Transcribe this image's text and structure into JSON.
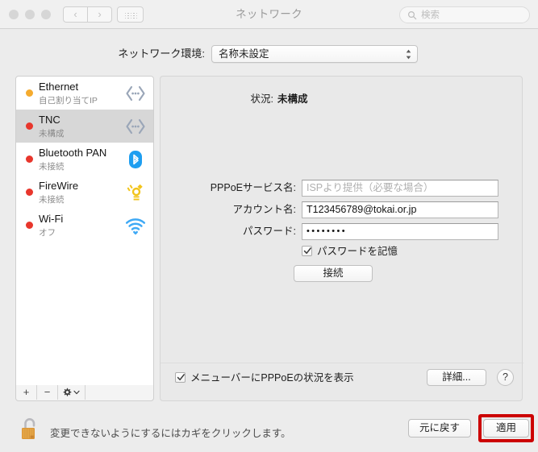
{
  "window": {
    "title": "ネットワーク",
    "traffic_lights": [
      "close",
      "minimize",
      "zoom"
    ]
  },
  "toolbar": {
    "back_glyph": "‹",
    "forward_glyph": "›",
    "show_all_name": "show-all-grid"
  },
  "search": {
    "placeholder": "検索",
    "value": ""
  },
  "location": {
    "label": "ネットワーク環境:",
    "selected": "名称未設定"
  },
  "sidebar": {
    "services": [
      {
        "name": "Ethernet",
        "status": "自己割り当てIP",
        "dot_color": "#f5ab2e",
        "icon": "ethernet-icon",
        "selected": false
      },
      {
        "name": "TNC",
        "status": "未構成",
        "dot_color": "#e8362c",
        "icon": "ethernet-icon",
        "selected": true
      },
      {
        "name": "Bluetooth PAN",
        "status": "未接続",
        "dot_color": "#e8362c",
        "icon": "bluetooth-icon",
        "selected": false
      },
      {
        "name": "FireWire",
        "status": "未接続",
        "dot_color": "#e8362c",
        "icon": "firewire-icon",
        "selected": false
      },
      {
        "name": "Wi-Fi",
        "status": "オフ",
        "dot_color": "#e8362c",
        "icon": "wifi-icon",
        "selected": false
      }
    ],
    "footer": {
      "add_label": "+",
      "remove_label": "−",
      "gear_name": "gear-icon"
    }
  },
  "detail": {
    "status_label": "状況:",
    "status_value": "未構成",
    "fields": [
      {
        "label": "PPPoEサービス名:",
        "value": "",
        "placeholder": "ISPより提供（必要な場合）",
        "masked": false
      },
      {
        "label": "アカウント名:",
        "value": "T123456789@tokai.or.jp",
        "placeholder": "",
        "masked": false
      },
      {
        "label": "パスワード:",
        "value": "••••••••",
        "placeholder": "",
        "masked": true
      }
    ],
    "remember_password": {
      "label": "パスワードを記憶",
      "checked": true
    },
    "connect_label": "接続",
    "menubar_status": {
      "label": "メニューバーにPPPoEの状況を表示",
      "checked": true
    },
    "advanced_label": "詳細...",
    "help_label": "?"
  },
  "bottom": {
    "lock_text": "変更できないようにするにはカギをクリックします。",
    "lock_state": "unlocked",
    "revert_label": "元に戻す",
    "apply_label": "適用",
    "apply_highlight_color": "#cc0000"
  }
}
